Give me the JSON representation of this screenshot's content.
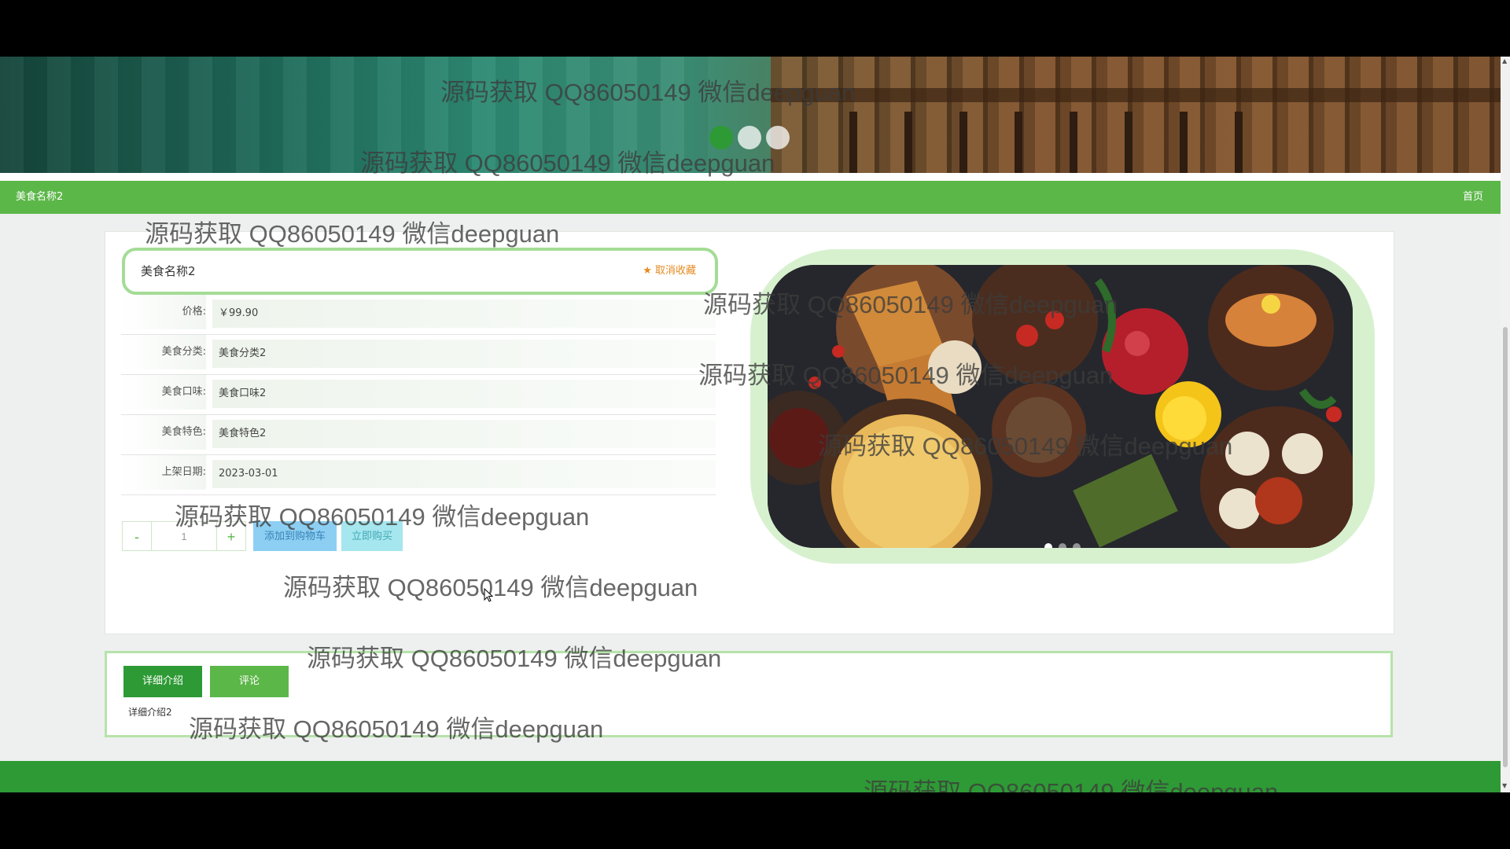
{
  "banner": {
    "dot_colors": [
      "#2e9a35",
      "#ffffff",
      "#ffffff"
    ]
  },
  "nav": {
    "title": "美食名称2",
    "home": "首页"
  },
  "product": {
    "name": "美食名称2",
    "fav_icon": "star-icon",
    "fav_label": "取消收藏",
    "fields": [
      {
        "label": "价格:",
        "value": "￥99.90"
      },
      {
        "label": "美食分类:",
        "value": "美食分类2"
      },
      {
        "label": "美食口味:",
        "value": "美食口味2"
      },
      {
        "label": "美食特色:",
        "value": "美食特色2"
      },
      {
        "label": "上架日期:",
        "value": "2023-03-01"
      }
    ]
  },
  "purchase": {
    "minus": "-",
    "quantity": "1",
    "plus": "+",
    "add_to_cart": "添加到购物车",
    "buy_now": "立即购买"
  },
  "detail": {
    "tabs": [
      "详细介绍",
      "评论"
    ],
    "content": "详细介绍2"
  },
  "watermark": "源码获取 QQ86050149 微信deepguan",
  "colors": {
    "primary": "#5cb749",
    "dark_primary": "#2e9a35",
    "accent": "#e58a1f"
  }
}
